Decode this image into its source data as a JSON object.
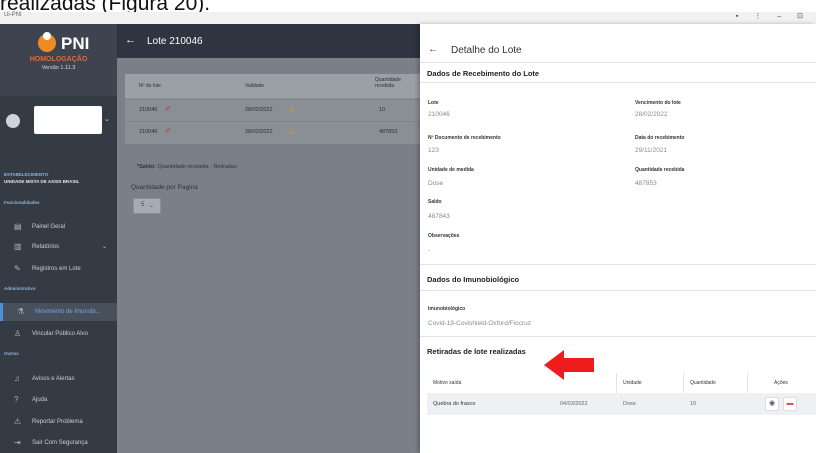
{
  "caption": "realizadas (Figura 20).",
  "window": {
    "title": "Ui-PNI",
    "controls": "▪ ⋮ – ⊡"
  },
  "sidebar": {
    "logo_text": "PNI",
    "environment": "HOMOLOGAÇÃO",
    "version": "Versão 1.11.3",
    "establishment_label": "ESTABELECIMENTO",
    "establishment_name": "UNIDADE MISTA DE ASSIS BRASIL",
    "section_funcionalidades": "Funcionalidades",
    "section_administrativo": "Administrativo",
    "section_outros": "Outros",
    "items": [
      {
        "label": "Painel Geral",
        "icon": "dashboard-icon"
      },
      {
        "label": "Relatórios",
        "icon": "reports-icon"
      },
      {
        "label": "Registros em Lote",
        "icon": "edit-icon"
      },
      {
        "label": "Movimento de Imunobi...",
        "icon": "flask-icon"
      },
      {
        "label": "Vincular Público Alvo",
        "icon": "user-icon"
      },
      {
        "label": "Avisos e Alertas",
        "icon": "bell-icon"
      },
      {
        "label": "Ajuda",
        "icon": "help-icon"
      },
      {
        "label": "Reportar Problema",
        "icon": "report-icon"
      },
      {
        "label": "Sair Com Segurança",
        "icon": "logout-icon"
      }
    ]
  },
  "main": {
    "title": "Lote 210046",
    "columns": [
      "Nº do lote",
      "Validade",
      "Quantidade recebida"
    ],
    "rows": [
      {
        "lote": "210046",
        "validade": "28/02/2022",
        "quantidade": "10"
      },
      {
        "lote": "210046",
        "validade": "28/02/2022",
        "quantidade": "487853"
      }
    ],
    "saldo_bold": "*Saldo:",
    "saldo_note": "Quantidade recebida - Retiradas",
    "per_page_label": "Quantidade por Pagina",
    "per_page_value": "5"
  },
  "panel": {
    "title": "Detalhe do Lote",
    "receb_title": "Dados de Recebimento do Lote",
    "fields": {
      "lote_label": "Lote",
      "lote_value": "210046",
      "venc_label": "Vencimento do lote",
      "venc_value": "28/02/2022",
      "doc_label": "Nº Documento de recebimento",
      "doc_value": "123",
      "data_label": "Data do recebimento",
      "data_value": "29/11/2021",
      "un_label": "Unidade de medida",
      "un_value": "Dose",
      "qtd_label": "Quantidade recebida",
      "qtd_value": "487853",
      "saldo_label": "Saldo",
      "saldo_value": "487843",
      "obs_label": "Observações",
      "obs_value": "-"
    },
    "imuno_title": "Dados do Imunobiológico",
    "imuno_label": "Imunobiológico",
    "imuno_value": "Covid-19-Covishield-Oxford/Fiocruz",
    "retiradas_title": "Retiradas de lote realizadas",
    "ret_columns": [
      "Motivo saída",
      "",
      "Unidade",
      "Quantidade",
      "Ações"
    ],
    "ret_row": {
      "motivo": "Quebra do frasco",
      "data": "04/03/2022",
      "unidade": "Dose",
      "quantidade": "10"
    }
  },
  "colors": {
    "arrow": "#ee1c1c",
    "active": "#4a8fd8",
    "logo": "#f08a24"
  }
}
